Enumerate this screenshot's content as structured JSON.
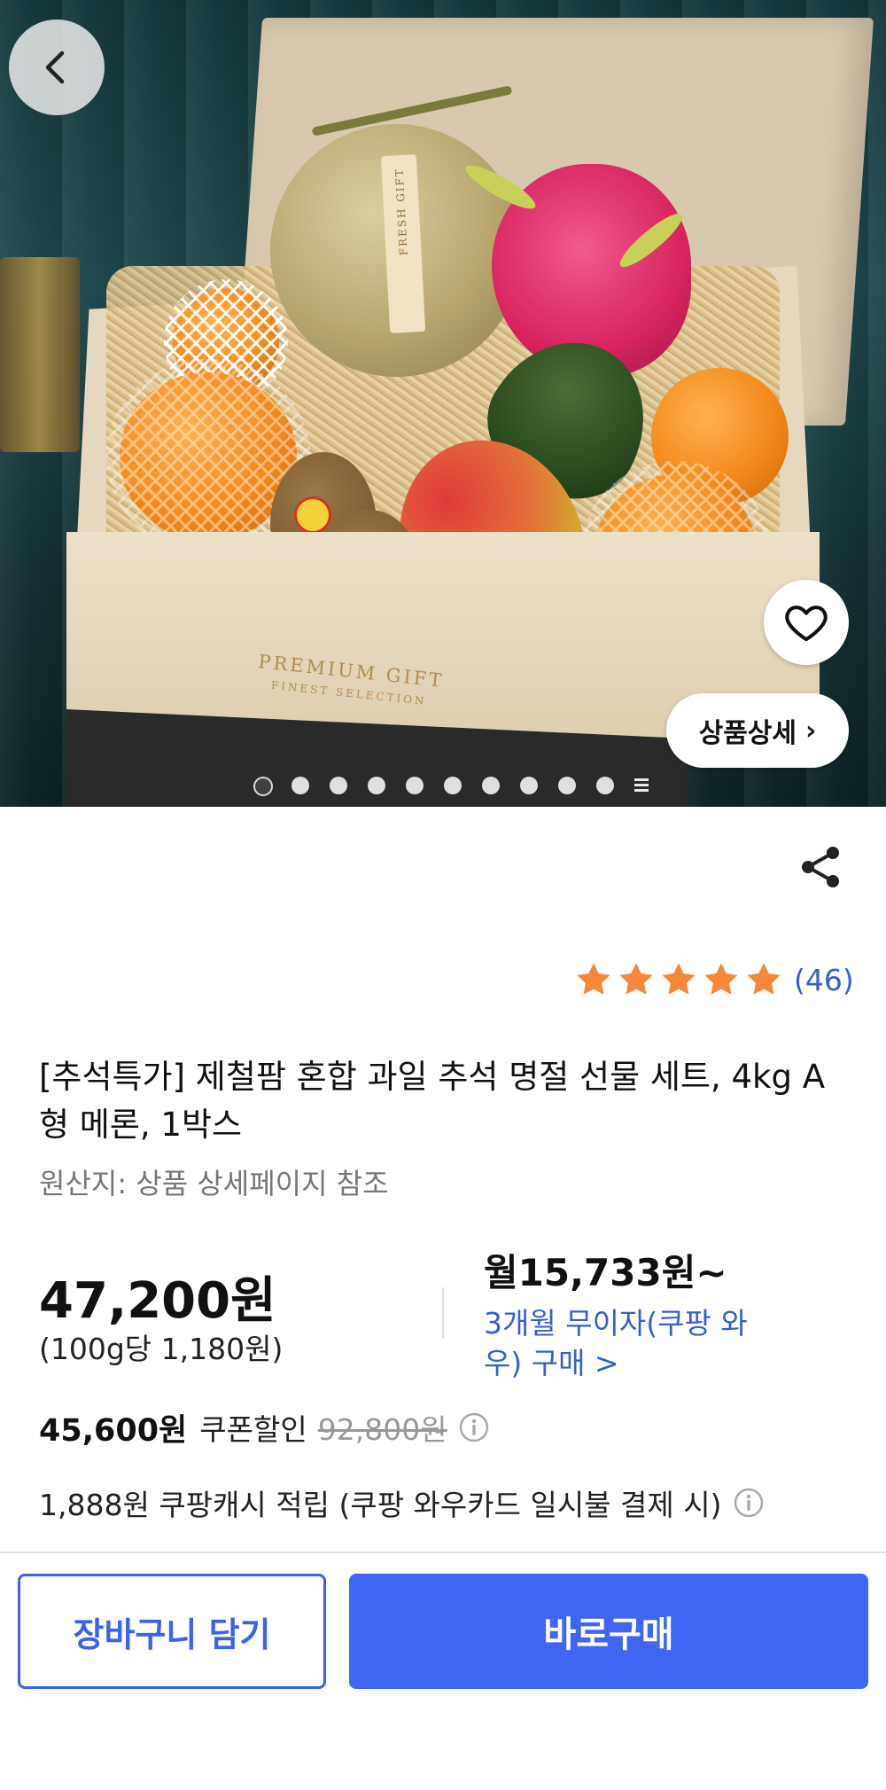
{
  "hero": {
    "box_print_line1": "PREMIUM GIFT",
    "box_print_line2": "FINEST SELECTION",
    "melon_tag": "FRESH GIFT",
    "detail_button_label": "상품상세",
    "carousel": {
      "total": 11,
      "active": 1
    }
  },
  "product": {
    "rating_stars": 5,
    "review_count": "(46)",
    "title": "[추석특가] 제철팜 혼합 과일 추석 명절 선물 세트, 4kg A형 메론, 1박스",
    "origin": "원산지: 상품 상세페이지 참조",
    "price": "47,200원",
    "unit_price": "(100g당 1,180원)",
    "monthly_price": "월15,733원~",
    "installment": "3개월 무이자(쿠팡 와우) 구매 >",
    "coupon_price": "45,600원",
    "coupon_label": "쿠폰할인",
    "original_price": "92,800원",
    "cashback": "1,888원 쿠팡캐시 적립 (쿠팡 와우카드 일시불 결제 시)"
  },
  "actions": {
    "cart_label": "장바구니 담기",
    "buy_label": "바로구매"
  },
  "icons": {
    "back": "back-arrow-icon",
    "wishlist": "heart-icon",
    "share": "share-icon",
    "info": "info-icon",
    "star": "star-icon"
  },
  "colors": {
    "accent_blue": "#3f66f0",
    "link_blue": "#3461cc",
    "star_orange": "#f5883a"
  }
}
